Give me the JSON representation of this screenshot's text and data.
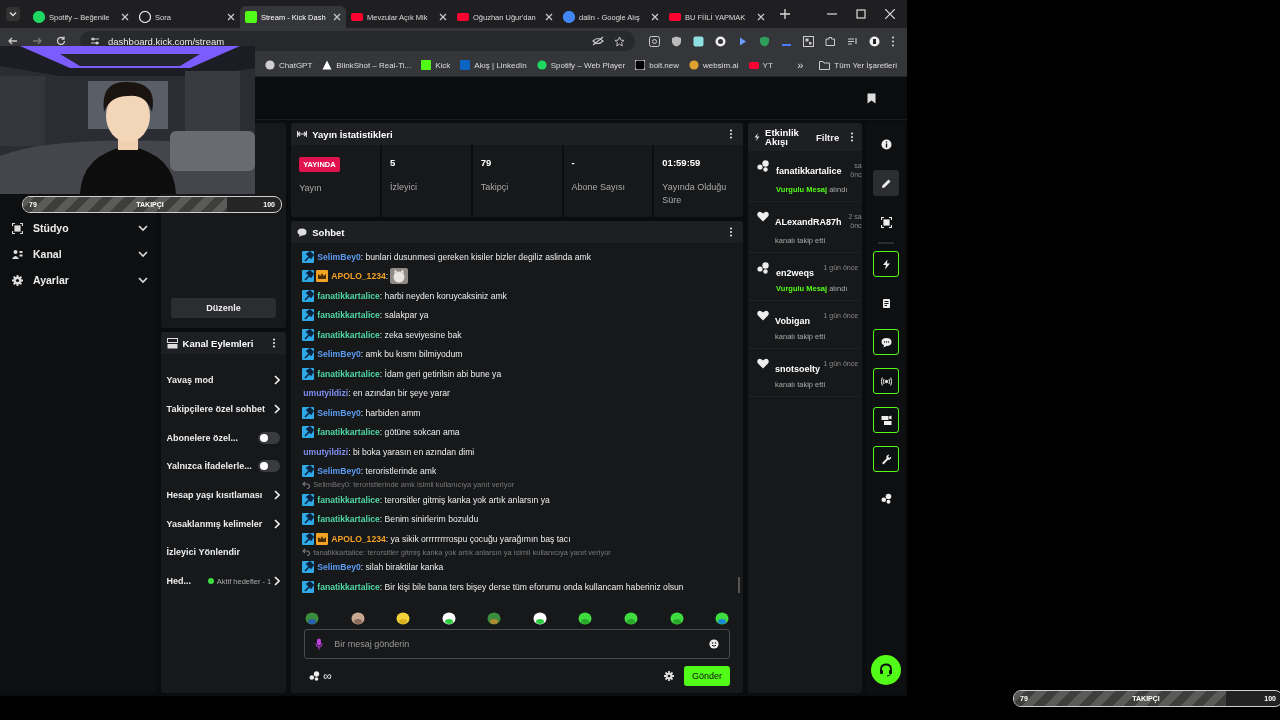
{
  "browser": {
    "tabs": [
      {
        "title": "Spotify – Beğenile",
        "kind": "spotify",
        "selected": false
      },
      {
        "title": "Sora",
        "kind": "sora",
        "selected": false
      },
      {
        "title": "Stream - Kick Dash",
        "kind": "kick",
        "selected": true
      },
      {
        "title": "Mevzular Açık Mik",
        "kind": "youtube",
        "selected": false
      },
      {
        "title": "Oğuzhan Uğur'dan",
        "kind": "youtube",
        "selected": false
      },
      {
        "title": "dalin - Google Alış",
        "kind": "google",
        "selected": false
      },
      {
        "title": "BU FİİLİ YAPMAK",
        "kind": "youtube",
        "selected": false
      }
    ],
    "address": "dashboard.kick.com/stream",
    "bookmarks": [
      {
        "label": "ChatGPT",
        "kind": "chatgpt"
      },
      {
        "label": "BlinkShot – Real-Ti...",
        "kind": "triangle"
      },
      {
        "label": "Kick",
        "kind": "kick"
      },
      {
        "label": "Akış | LinkedIn",
        "kind": "linkedin"
      },
      {
        "label": "Spotify – Web Player",
        "kind": "spotify"
      },
      {
        "label": "bolt.new",
        "kind": "bolt"
      },
      {
        "label": "websim.ai",
        "kind": "globe"
      },
      {
        "label": "YT",
        "kind": "youtube"
      }
    ],
    "more": "»",
    "all_bookmarks": "Tüm Yer İşaretleri"
  },
  "goal_bars": [
    {
      "start": "79",
      "label": "TAKIPÇI",
      "end": "100",
      "level": 0.79
    },
    {
      "start": "79",
      "label": "TAKIPÇI",
      "end": "100",
      "level": 0.79
    }
  ],
  "sidebar": {
    "items": [
      {
        "label": "Stüdyo",
        "kind": "studio"
      },
      {
        "label": "Kanal",
        "kind": "channel"
      },
      {
        "label": "Ayarlar",
        "kind": "settings"
      }
    ]
  },
  "stream_info": {
    "edit_button": "Düzenle"
  },
  "channel_actions": {
    "title": "Kanal Eylemleri",
    "items": [
      {
        "kind": "link",
        "label": "Yavaş mod"
      },
      {
        "kind": "link",
        "label": "Takipçilere özel sohbet"
      },
      {
        "kind": "toggle",
        "label": "Abonelere özel...",
        "on": false
      },
      {
        "kind": "toggle",
        "label": "Yalnızca İfadelerle...",
        "on": false
      },
      {
        "kind": "link",
        "label": "Hesap yaşı kısıtlaması"
      },
      {
        "kind": "link",
        "label": "Yasaklanmış kelimeler"
      },
      {
        "kind": "plain",
        "label": "İzleyici Yönlendir"
      },
      {
        "kind": "goal",
        "label": "Hed...",
        "status": "Aktif hedefler - 1"
      }
    ]
  },
  "stats": {
    "title": "Yayın İstatistikleri",
    "live_badge": "YAYINDA",
    "live_label": "Yayın",
    "items": [
      {
        "value": "5",
        "label": "İzleyici"
      },
      {
        "value": "79",
        "label": "Takipçi"
      },
      {
        "value": "-",
        "label": "Abone Sayısı"
      },
      {
        "value": "01:59:59",
        "label": "Yayında Olduğu Süre"
      }
    ]
  },
  "chat": {
    "title": "Sohbet",
    "messages": [
      {
        "kind": "message",
        "user": "SelimBey0",
        "color": "#5b9cf2",
        "mod": true,
        "vip": false,
        "text": ": bunlari dusunmesi gereken kisiler bizler degiliz aslinda amk"
      },
      {
        "kind": "message",
        "user": "APOLO_1234",
        "color": "#f2a324",
        "mod": true,
        "vip": true,
        "text": ":",
        "emote": true
      },
      {
        "kind": "message",
        "user": "fanatikkartalice",
        "color": "#4fd8a4",
        "mod": true,
        "vip": false,
        "text": ": harbi neyden koruycaksiniz amk"
      },
      {
        "kind": "message",
        "user": "fanatikkartalice",
        "color": "#4fd8a4",
        "mod": true,
        "vip": false,
        "text": ": salakpar ya"
      },
      {
        "kind": "message",
        "user": "fanatikkartalice",
        "color": "#4fd8a4",
        "mod": true,
        "vip": false,
        "text": ": zeka seviyesine bak"
      },
      {
        "kind": "message",
        "user": "SelimBey0",
        "color": "#5b9cf2",
        "mod": true,
        "vip": false,
        "text": ": amk bu kısmı bilmiyodum"
      },
      {
        "kind": "message",
        "user": "fanatikkartalice",
        "color": "#4fd8a4",
        "mod": true,
        "vip": false,
        "text": ": İdam geri getirilsin abi bune ya"
      },
      {
        "kind": "message",
        "user": "umutyildizi",
        "color": "#7f8ef2",
        "mod": false,
        "vip": false,
        "text": ": en azından bir şeye yarar"
      },
      {
        "kind": "message",
        "user": "SelimBey0",
        "color": "#5b9cf2",
        "mod": true,
        "vip": false,
        "text": ": harbiden amm"
      },
      {
        "kind": "message",
        "user": "fanatikkartalice",
        "color": "#4fd8a4",
        "mod": true,
        "vip": false,
        "text": ": götüne sokcan ama"
      },
      {
        "kind": "message",
        "user": "umutyildizi",
        "color": "#7f8ef2",
        "mod": false,
        "vip": false,
        "text": ": bi boka yarasın en azından dimi"
      },
      {
        "kind": "message",
        "user": "SelimBey0",
        "color": "#5b9cf2",
        "mod": true,
        "vip": false,
        "text": ": teroristlerinde amk"
      },
      {
        "kind": "reply",
        "text": "SelimBey0: teroristlerinde amk isimli kullanıcıya yanıt veriyor"
      },
      {
        "kind": "message",
        "user": "fanatikkartalice",
        "color": "#4fd8a4",
        "mod": true,
        "vip": false,
        "text": ": terorsitler gitmiş kanka yok artık anlarsın ya"
      },
      {
        "kind": "message",
        "user": "fanatikkartalice",
        "color": "#4fd8a4",
        "mod": true,
        "vip": false,
        "text": ": Benim sinirlerim bozuldu"
      },
      {
        "kind": "message",
        "user": "APOLO_1234",
        "color": "#f2a324",
        "mod": true,
        "vip": true,
        "text": ": ya sikik orrrrrrrrospu çocuğu yarağımın baş tacı"
      },
      {
        "kind": "reply",
        "text": "fanatikkartalice: terorsitler gitmiş kanka yok artık anlarsın ya isimli kullanıcıya yanıt veriyor"
      },
      {
        "kind": "message",
        "user": "SelimBey0",
        "color": "#5b9cf2",
        "mod": true,
        "vip": false,
        "text": ": silah biraktilar kanka"
      },
      {
        "kind": "message",
        "user": "fanatikkartalice",
        "color": "#4fd8a4",
        "mod": true,
        "vip": false,
        "text": ": Bir kişi bile bana ters bişey derse tüm eforumu onda kullancam haberiniz olsun"
      }
    ],
    "input_placeholder": "Bir mesaj gönderin",
    "infinity": "∞",
    "send_button": "Gönder"
  },
  "activity": {
    "title": "Etkinlik Akışı",
    "filter": "Filtre",
    "events": [
      {
        "kind": "highlight",
        "name": "fanatikkartalice",
        "time": "sa önc",
        "highlight": "Vurgulu Mesaj",
        "action": "alındı"
      },
      {
        "kind": "follow",
        "name": "ALexandRA87h",
        "time": "2 sa önc",
        "action": "kanalı takip etti"
      },
      {
        "kind": "highlight",
        "name": "en2weqs",
        "time": "1 gün önce",
        "highlight": "Vurgulu Mesaj",
        "action": "alındı"
      },
      {
        "kind": "follow",
        "name": "Vobigan",
        "time": "1 gün önce",
        "action": "kanalı takip etti"
      },
      {
        "kind": "follow",
        "name": "snotsoelty",
        "time": "1 gün önce",
        "action": "kanalı takip etti"
      }
    ]
  },
  "rail": [
    {
      "kind": "info",
      "active": false,
      "on": false
    },
    {
      "kind": "edit",
      "active": true,
      "on": false
    },
    {
      "kind": "focus",
      "active": false,
      "on": false
    },
    {
      "kind": "bolt",
      "active": false,
      "on": true
    },
    {
      "kind": "notes",
      "active": false,
      "on": false
    },
    {
      "kind": "chat",
      "active": false,
      "on": true
    },
    {
      "kind": "broadcast",
      "active": false,
      "on": true
    },
    {
      "kind": "camera",
      "active": false,
      "on": true
    },
    {
      "kind": "wrench",
      "active": false,
      "on": true
    },
    {
      "kind": "dots",
      "active": false,
      "on": false
    }
  ]
}
